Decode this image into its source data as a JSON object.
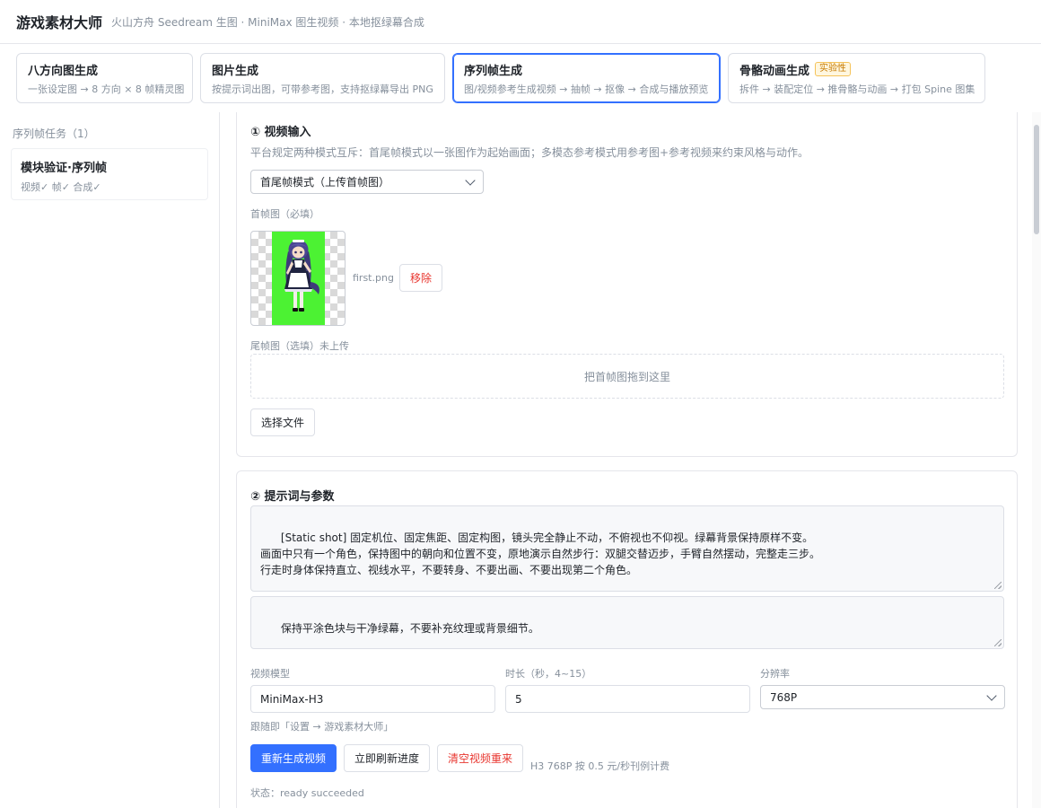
{
  "header": {
    "title": "游戏素材大师",
    "subtitle": "火山方舟 Seedream 生图 · MiniMax 图生视频 · 本地抠绿幕合成"
  },
  "tabs": [
    {
      "title": "八方向图生成",
      "desc": "一张设定图 → 8 方向 × 8 帧精灵图"
    },
    {
      "title": "图片生成",
      "desc": "按提示词出图，可带参考图，支持抠绿幕导出 PNG"
    },
    {
      "title": "序列帧生成",
      "desc": "图/视频参考生成视频 → 抽帧 → 抠像 → 合成与播放预览"
    },
    {
      "title": "骨骼动画生成",
      "badge": "实验性",
      "desc": "拆件 → 装配定位 → 推骨骼与动画 → 打包 Spine 图集"
    }
  ],
  "sidebar": {
    "heading": "序列帧任务（1）",
    "tasks": [
      {
        "title": "模块验证·序列帧",
        "status": "视频✓ 帧✓ 合成✓"
      }
    ]
  },
  "video_input": {
    "title": "① 视频输入",
    "desc": "平台规定两种模式互斥：首尾帧模式以一张图作为起始画面；多模态参考模式用参考图+参考视频来约束风格与动作。",
    "mode_selected": "首尾帧模式（上传首帧图）",
    "first_frame_label": "首帧图（必填）",
    "first_frame_file": "first.png",
    "remove_label": "移除",
    "last_frame_label": "尾帧图（选填）未上传",
    "dropzone_text": "把首帧图拖到这里",
    "choose_file_label": "选择文件"
  },
  "prompt_params": {
    "title": "② 提示词与参数",
    "prompt": "[Static shot] 固定机位、固定焦距、固定构图，镜头完全静止不动，不俯视也不仰视。绿幕背景保持原样不变。\n画面中只有一个角色，保持图中的朝向和位置不变，原地演示自然步行：双腿交替迈步，手臂自然摆动，完整走三步。\n行走时身体保持直立、视线水平，不要转身、不要出画、不要出现第二个角色。",
    "negative_prompt": "保持平涂色块与干净绿幕，不要补充纹理或背景细节。",
    "model_label": "视频模型",
    "model_value": "MiniMax-H3",
    "duration_label": "时长（秒，4~15）",
    "duration_value": "5",
    "resolution_label": "分辨率",
    "resolution_value": "768P",
    "follow_note": "跟随即「设置 → 游戏素材大师」",
    "regen_label": "重新生成视频",
    "refresh_label": "立即刷新进度",
    "clear_label": "清空视频重来",
    "cost_note": "H3 768P 按 0.5 元/秒刊例计费",
    "status_text": "状态：ready succeeded"
  },
  "colors": {
    "accent": "#3370ff",
    "danger": "#e8362f",
    "greenscreen": "#4cf233",
    "badge": "#c77a00"
  }
}
